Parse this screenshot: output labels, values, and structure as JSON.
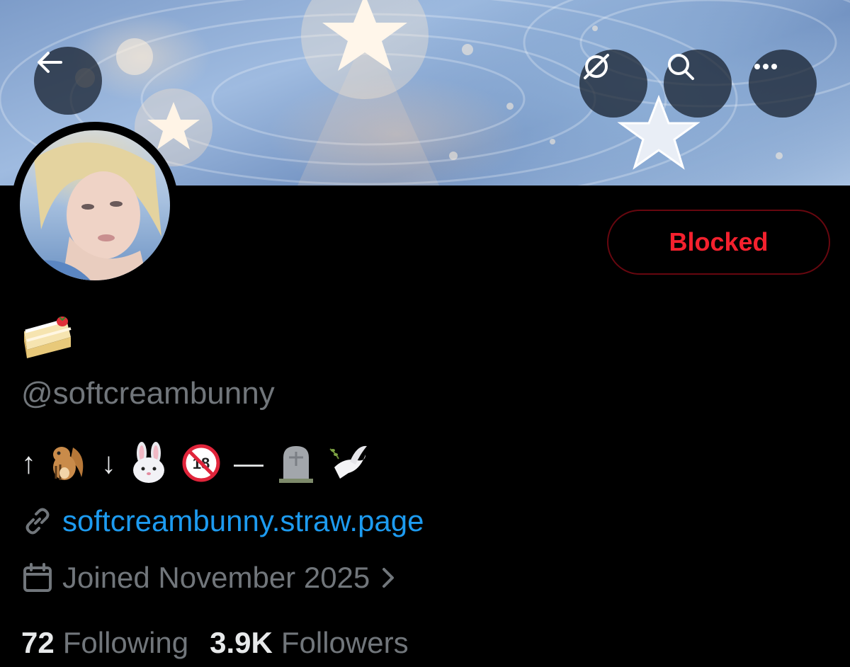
{
  "header": {
    "back_icon": "arrow-left-icon",
    "grok_icon": "grok-icon",
    "search_icon": "search-icon",
    "more_icon": "more-horizontal-icon"
  },
  "profile": {
    "name_emoji": "shortcake-emoji",
    "handle": "@softcreambunny",
    "bio": {
      "up_arrow": "↑",
      "down_arrow": "↓",
      "dash": "—",
      "emojis": [
        "chipmunk",
        "rabbit-face",
        "no-one-under-eighteen",
        "headstone",
        "dove"
      ]
    },
    "link": "softcreambunny.straw.page",
    "joined": "Joined November 2025",
    "following_count": "72",
    "following_label": "Following",
    "followers_count": "3.9K",
    "followers_label": "Followers"
  },
  "actions": {
    "blocked_label": "Blocked"
  },
  "colors": {
    "background": "#000000",
    "primary_text": "#e7e9ea",
    "secondary_text": "#71767b",
    "link": "#1d9bf0",
    "blocked_red": "#f4212e",
    "blocked_border": "#67070f"
  }
}
